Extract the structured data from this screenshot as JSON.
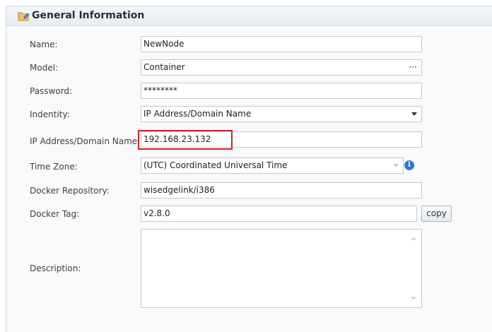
{
  "panel": {
    "title": "General Information",
    "header_icon": "folder-edit-icon"
  },
  "form": {
    "name": {
      "label": "Name:",
      "value": "NewNode"
    },
    "model": {
      "label": "Model:",
      "value": "Container",
      "trailing": "···"
    },
    "password": {
      "label": "Password:",
      "value": "********"
    },
    "identity": {
      "label": "Indentity:",
      "value": "IP Address/Domain Name"
    },
    "ip_address": {
      "label": "IP Address/Domain Name:",
      "value": "192.168.23.132"
    },
    "time_zone": {
      "label": "Time Zone:",
      "value": "(UTC) Coordinated Universal Time",
      "info_icon_text": "i"
    },
    "docker_repository": {
      "label": "Docker Repository:",
      "value": "wisedgelink/i386"
    },
    "docker_tag": {
      "label": "Docker Tag:",
      "value": "v2.8.0",
      "copy_label": "copy"
    },
    "description": {
      "label": "Description:",
      "value": ""
    }
  },
  "colors": {
    "highlight": "#d0232a",
    "info_icon": "#2f78d0"
  }
}
